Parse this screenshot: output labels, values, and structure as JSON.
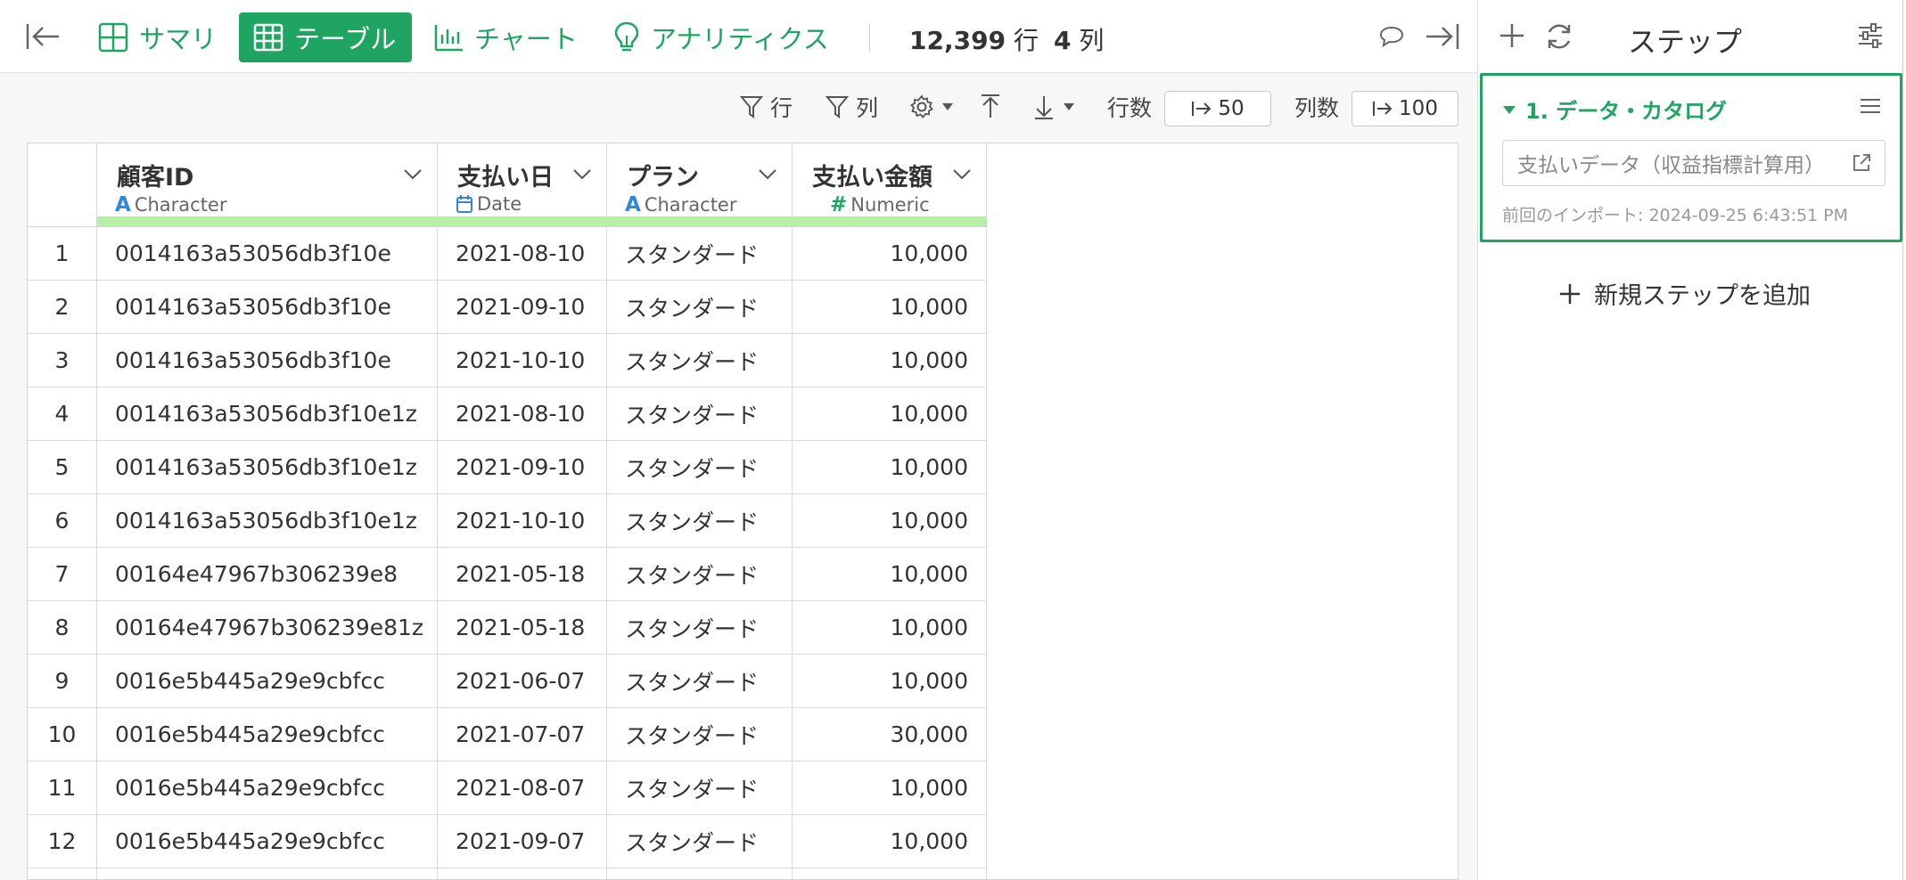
{
  "topbar": {
    "tabs": [
      {
        "label": "サマリ",
        "icon": "summary-grid-icon",
        "active": false
      },
      {
        "label": "テーブル",
        "icon": "table-icon",
        "active": true
      },
      {
        "label": "チャート",
        "icon": "bar-chart-icon",
        "active": false
      },
      {
        "label": "アナリティクス",
        "icon": "lightbulb-icon",
        "active": false
      }
    ],
    "row_count": "12,399",
    "row_unit": "行",
    "col_count": "4",
    "col_unit": "列"
  },
  "toolbar": {
    "row_filter_label": "行",
    "col_filter_label": "列",
    "rows_label": "行数",
    "rows_value": "50",
    "cols_label": "列数",
    "cols_value": "100"
  },
  "table": {
    "columns": [
      {
        "name": "顧客ID",
        "type": "Character",
        "type_icon": "A"
      },
      {
        "name": "支払い日",
        "type": "Date",
        "type_icon": "calendar"
      },
      {
        "name": "プラン",
        "type": "Character",
        "type_icon": "A"
      },
      {
        "name": "支払い金額",
        "type": "Numeric",
        "type_icon": "#"
      }
    ],
    "rows": [
      {
        "idx": "1",
        "id": "0014163a53056db3f10e",
        "date": "2021-08-10",
        "plan": "スタンダード",
        "amount": "10,000"
      },
      {
        "idx": "2",
        "id": "0014163a53056db3f10e",
        "date": "2021-09-10",
        "plan": "スタンダード",
        "amount": "10,000"
      },
      {
        "idx": "3",
        "id": "0014163a53056db3f10e",
        "date": "2021-10-10",
        "plan": "スタンダード",
        "amount": "10,000"
      },
      {
        "idx": "4",
        "id": "0014163a53056db3f10e1z",
        "date": "2021-08-10",
        "plan": "スタンダード",
        "amount": "10,000"
      },
      {
        "idx": "5",
        "id": "0014163a53056db3f10e1z",
        "date": "2021-09-10",
        "plan": "スタンダード",
        "amount": "10,000"
      },
      {
        "idx": "6",
        "id": "0014163a53056db3f10e1z",
        "date": "2021-10-10",
        "plan": "スタンダード",
        "amount": "10,000"
      },
      {
        "idx": "7",
        "id": "00164e47967b306239e8",
        "date": "2021-05-18",
        "plan": "スタンダード",
        "amount": "10,000"
      },
      {
        "idx": "8",
        "id": "00164e47967b306239e81z",
        "date": "2021-05-18",
        "plan": "スタンダード",
        "amount": "10,000"
      },
      {
        "idx": "9",
        "id": "0016e5b445a29e9cbfcc",
        "date": "2021-06-07",
        "plan": "スタンダード",
        "amount": "10,000"
      },
      {
        "idx": "10",
        "id": "0016e5b445a29e9cbfcc",
        "date": "2021-07-07",
        "plan": "スタンダード",
        "amount": "30,000"
      },
      {
        "idx": "11",
        "id": "0016e5b445a29e9cbfcc",
        "date": "2021-08-07",
        "plan": "スタンダード",
        "amount": "10,000"
      },
      {
        "idx": "12",
        "id": "0016e5b445a29e9cbfcc",
        "date": "2021-09-07",
        "plan": "スタンダード",
        "amount": "10,000"
      }
    ]
  },
  "steps_panel": {
    "title": "ステップ",
    "step": {
      "title": "1. データ・カタログ",
      "source": "支払いデータ（収益指標計算用）",
      "import_info": "前回のインポート: 2024-09-25 6:43:51 PM"
    },
    "add_step_label": "新規ステップを追加"
  },
  "colors": {
    "accent": "#1fa461",
    "type_bar": "#b6f0a6",
    "char_icon": "#2e86de"
  }
}
